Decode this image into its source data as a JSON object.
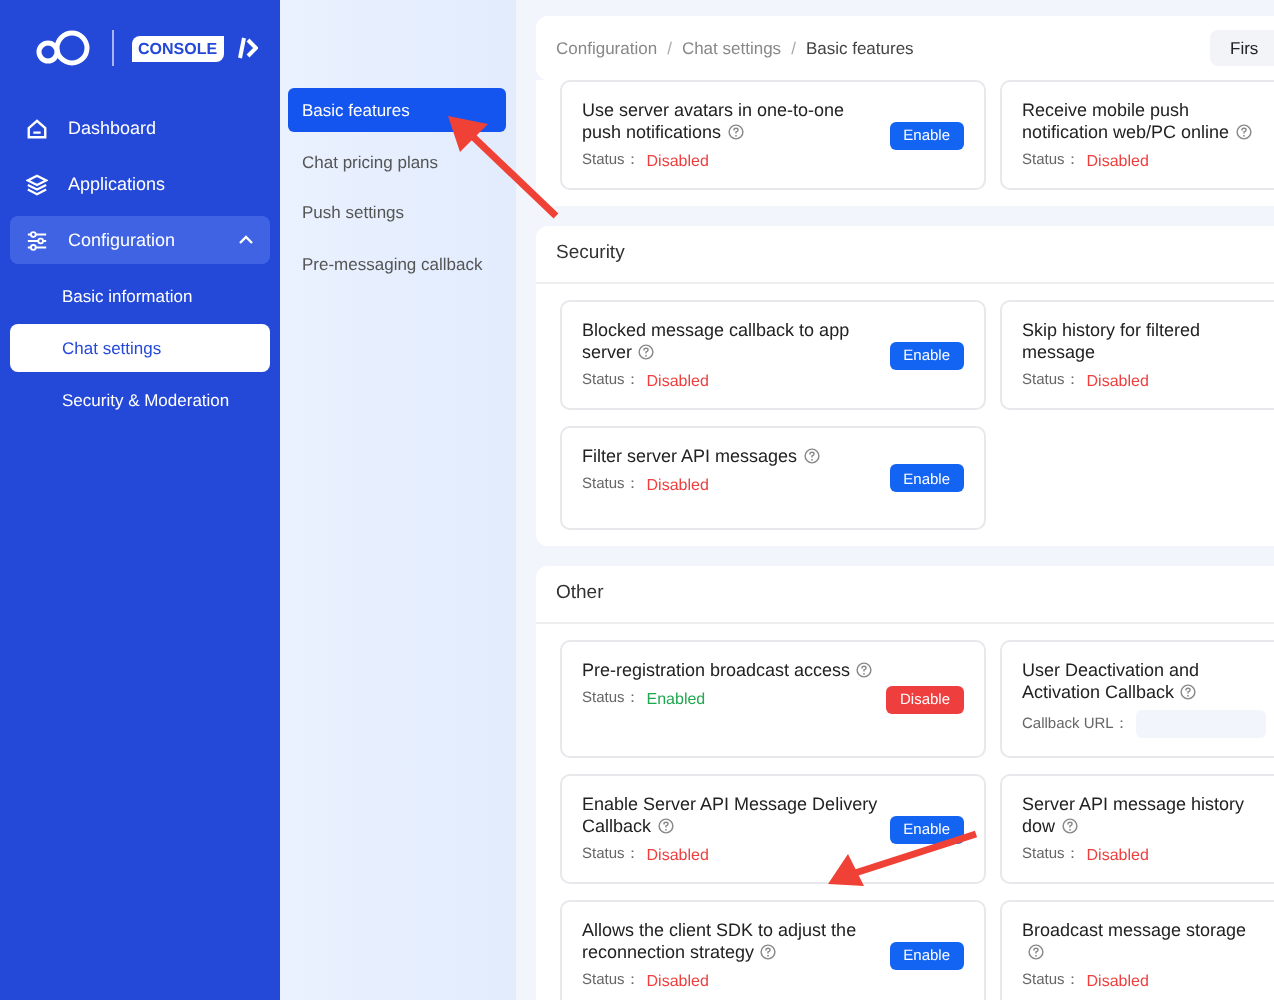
{
  "logo": {
    "badge": "CONSOLE"
  },
  "sidebar": {
    "items": [
      {
        "label": "Dashboard",
        "selected": false
      },
      {
        "label": "Applications",
        "selected": false
      },
      {
        "label": "Configuration",
        "selected": true,
        "expanded": true,
        "children": [
          {
            "label": "Basic information",
            "selected": false
          },
          {
            "label": "Chat settings",
            "selected": true
          },
          {
            "label": "Security & Moderation",
            "selected": false
          }
        ]
      }
    ]
  },
  "subnav": {
    "items": [
      {
        "label": "Basic features",
        "selected": true
      },
      {
        "label": "Chat pricing plans",
        "selected": false
      },
      {
        "label": "Push settings",
        "selected": false
      },
      {
        "label": "Pre-messaging callback",
        "selected": false
      }
    ]
  },
  "breadcrumb": [
    {
      "label": "Configuration"
    },
    {
      "separator": "/",
      "label": "Chat settings"
    },
    {
      "separator": "/",
      "label": "Basic features"
    }
  ],
  "header_button": "Firs",
  "sections": [
    {
      "cards": [
        {
          "kind": "toggle",
          "title": "Use server avatars in one-to-one push notifications",
          "help": true,
          "status_label": "Status：",
          "status": "Disabled",
          "enabled": false,
          "button": "Enable"
        },
        {
          "kind": "toggle",
          "title": "Receive mobile push notification web/PC online",
          "help": true,
          "status_label": "Status：",
          "status": "Disabled",
          "enabled": false
        }
      ]
    },
    {
      "title": "Security",
      "cards": [
        {
          "kind": "toggle",
          "title": "Blocked message callback to app server",
          "help": true,
          "status_label": "Status：",
          "status": "Disabled",
          "enabled": false,
          "button": "Enable"
        },
        {
          "kind": "toggle",
          "title": "Skip history for filtered message",
          "help": false,
          "status_label": "Status：",
          "status": "Disabled",
          "enabled": false
        },
        {
          "kind": "toggle",
          "title": "Filter server API messages",
          "help": true,
          "status_label": "Status：",
          "status": "Disabled",
          "enabled": false,
          "button": "Enable"
        }
      ]
    },
    {
      "title": "Other",
      "cards": [
        {
          "kind": "toggle",
          "title": "Pre-registration broadcast access",
          "help": true,
          "status_label": "Status：",
          "status": "Enabled",
          "enabled": true,
          "button": "Disable"
        },
        {
          "kind": "url",
          "title": "User Deactivation and Activation Callback",
          "help": true,
          "field_label": "Callback URL："
        },
        {
          "kind": "toggle",
          "title": "Enable Server API Message Delivery Callback",
          "help": true,
          "status_label": "Status：",
          "status": "Disabled",
          "enabled": false,
          "button": "Enable"
        },
        {
          "kind": "toggle",
          "title": "Server API message history dow",
          "help": true,
          "status_label": "Status：",
          "status": "Disabled",
          "enabled": false
        },
        {
          "kind": "toggle",
          "title": "Allows the client SDK to adjust the reconnection strategy",
          "help": true,
          "status_label": "Status：",
          "status": "Disabled",
          "enabled": false,
          "button": "Enable"
        },
        {
          "kind": "toggle",
          "title": "Broadcast message storage",
          "help": true,
          "status_label": "Status：",
          "status": "Disabled",
          "enabled": false
        }
      ]
    }
  ]
}
